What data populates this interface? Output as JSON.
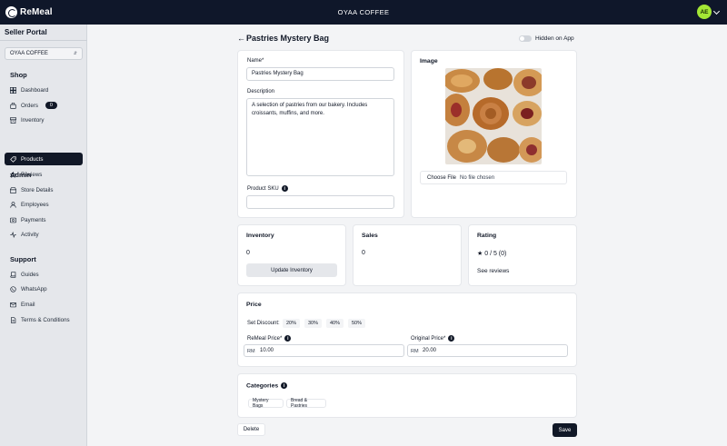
{
  "topbar": {
    "logo_text": "ReMeal",
    "store_title": "OYAA COFFEE",
    "avatar_initials": "AE"
  },
  "sidebar": {
    "portal_title": "Seller Portal",
    "store_select_value": "OYAA COFFEE",
    "sections": [
      {
        "heading": "Shop"
      },
      {
        "heading": "Admin"
      },
      {
        "heading": "Support"
      }
    ],
    "shop_items": [
      {
        "label": "Dashboard",
        "icon": "dashboard-icon"
      },
      {
        "label": "Orders",
        "icon": "bag-icon",
        "badge": "0"
      },
      {
        "label": "Inventory",
        "icon": "inventory-icon"
      },
      {
        "label": "Products",
        "icon": "tag-icon",
        "active": true
      },
      {
        "label": "Reviews",
        "icon": "star-icon"
      }
    ],
    "admin_items": [
      {
        "label": "Store Details",
        "icon": "store-icon"
      },
      {
        "label": "Employees",
        "icon": "user-icon"
      },
      {
        "label": "Payments",
        "icon": "payment-icon"
      },
      {
        "label": "Activity",
        "icon": "activity-icon"
      }
    ],
    "support_items": [
      {
        "label": "Guides",
        "icon": "book-icon"
      },
      {
        "label": "WhatsApp",
        "icon": "whatsapp-icon"
      },
      {
        "label": "Email",
        "icon": "mail-icon"
      },
      {
        "label": "Terms & Conditions",
        "icon": "document-icon"
      }
    ]
  },
  "page": {
    "title": "Pastries Mystery Bag",
    "visibility_label": "Hidden on App",
    "visibility_on": false
  },
  "details": {
    "name_label": "Name*",
    "name_value": "Pastries Mystery Bag",
    "description_label": "Description",
    "description_value": "A selection of pastries from our bakery. Includes croissants, muffins, and more.",
    "sku_label": "Product SKU",
    "sku_value": ""
  },
  "image": {
    "title": "Image",
    "choose_file_label": "Choose File",
    "file_status": "No file chosen"
  },
  "inventory": {
    "title": "Inventory",
    "value": "0",
    "button_label": "Update Inventory"
  },
  "sales": {
    "title": "Sales",
    "value": "0"
  },
  "rating": {
    "title": "Rating",
    "value": "0 / 5 (0)",
    "link_label": "See reviews"
  },
  "price": {
    "title": "Price",
    "discount_label": "Set Discount:",
    "discounts": [
      "20%",
      "30%",
      "40%",
      "50%"
    ],
    "remeal_label": "ReMeal Price*",
    "remeal_currency": "RM",
    "remeal_value": "10.00",
    "original_label": "Original Price*",
    "original_currency": "RM",
    "original_value": "20.00"
  },
  "categories": {
    "title": "Categories",
    "items": [
      "Mystery Bags",
      "Bread & Pastries"
    ]
  },
  "actions": {
    "delete_label": "Delete",
    "save_label": "Save"
  }
}
